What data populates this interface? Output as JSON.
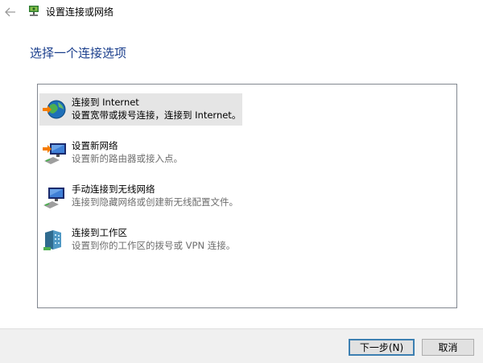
{
  "titlebar": {
    "back_icon": "back-arrow-icon",
    "app_icon": "network-setup-icon",
    "title": "设置连接或网络"
  },
  "heading": "选择一个连接选项",
  "options": [
    {
      "title": "连接到 Internet",
      "description": "设置宽带或拨号连接，连接到 Internet。",
      "icon": "globe-icon",
      "selected": true
    },
    {
      "title": "设置新网络",
      "description": "设置新的路由器或接入点。",
      "icon": "new-network-icon",
      "selected": false
    },
    {
      "title": "手动连接到无线网络",
      "description": "连接到隐藏网络或创建新无线配置文件。",
      "icon": "wireless-network-icon",
      "selected": false
    },
    {
      "title": "连接到工作区",
      "description": "设置到你的工作区的拨号或 VPN 连接。",
      "icon": "workplace-icon",
      "selected": false
    }
  ],
  "footer": {
    "next_label": "下一步(N)",
    "cancel_label": "取消"
  },
  "colors": {
    "heading": "#1a3e8c",
    "selected_bg": "#e5e5e5",
    "footer_bg": "#f0f0f0",
    "default_button_border": "#3c7fb1"
  }
}
